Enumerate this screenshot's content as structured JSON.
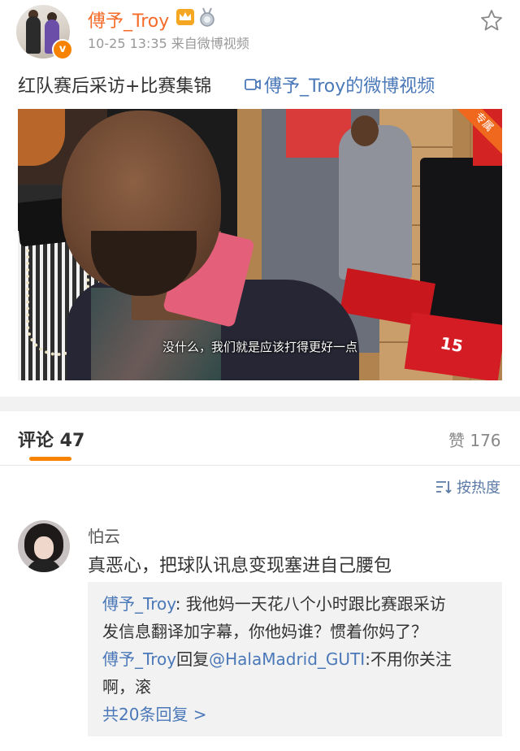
{
  "post": {
    "author": "傅予_Troy",
    "verified_badge": "v",
    "meta": "10-25 13:35  来自微博视频",
    "text": "红队赛后采访+比赛集锦",
    "link_text": "傅予_Troy的微博视频",
    "icons": [
      "crown-icon",
      "medal-icon",
      "star-icon",
      "video-link-icon"
    ]
  },
  "video": {
    "subtitle": "没什么，我们就是应该打得更好一点",
    "exclusive_badge": "专属",
    "jersey_text": "15"
  },
  "comments_section": {
    "tab_label": "评论 47",
    "likes_label": "赞 176",
    "sort_label": "按热度"
  },
  "comment": {
    "author": "怕云",
    "text": "真恶心，把球队讯息变现塞进自己腰包",
    "replies": {
      "reply1_name": "傅予_Troy",
      "reply1_text_a": ": 我他妈一天花八个小时跟比赛跟采访",
      "reply1_text_b": "发信息翻译加字幕，你他妈谁？惯着你妈了？",
      "reply2_name": "傅予_Troy",
      "reply2_verb": "回复",
      "reply2_mention": "@HalaMadrid_GUTI",
      "reply2_text_a": ":不用你关注",
      "reply2_text_b": "啊，滚",
      "more_label": "共20条回复 >"
    }
  },
  "colors": {
    "username": "#f56b2a",
    "link": "#4a78b8",
    "accent": "#f78300",
    "meta": "#999999"
  }
}
